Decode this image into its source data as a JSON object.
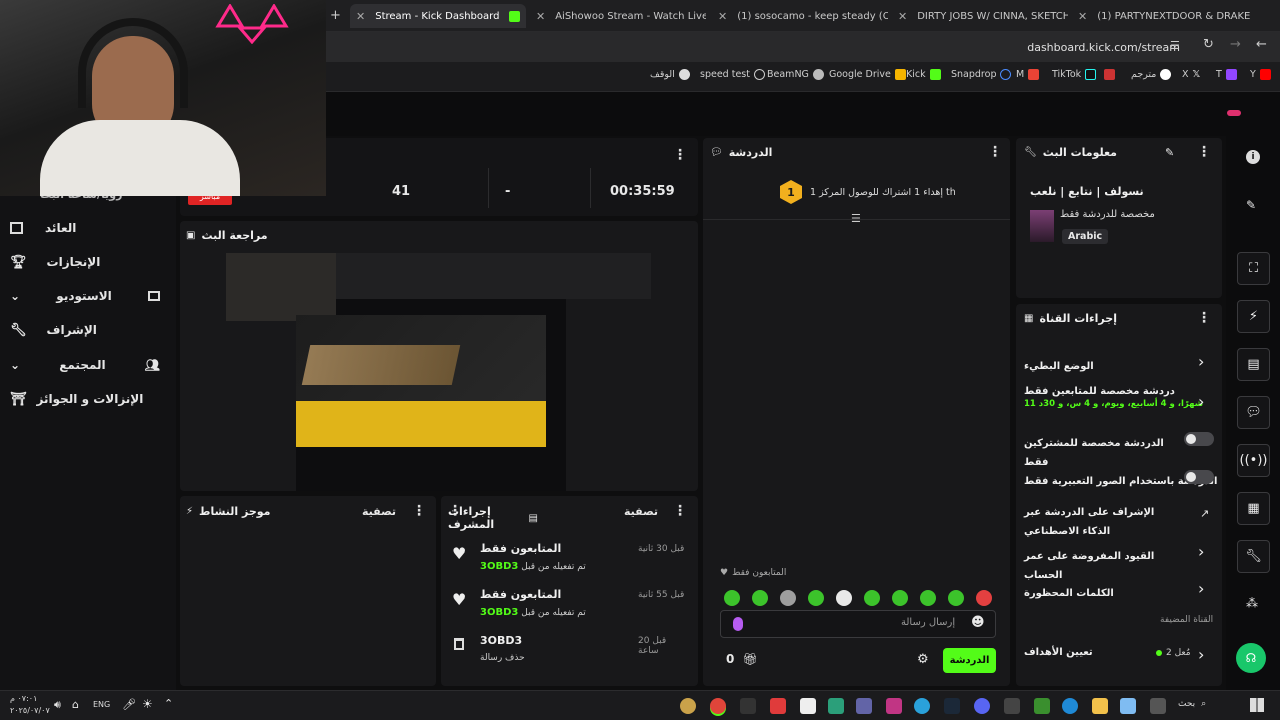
{
  "browser": {
    "tabs": [
      {
        "label": "Stream - Kick Dashboard",
        "active": true
      },
      {
        "label": "AiShowoo Stream - Watch Live on"
      },
      {
        "label": "(1) sosocamo - keep steady (Offici"
      },
      {
        "label": "DIRTY JOBS W/ CINNA, SKETCH, M"
      },
      {
        "label": "(1) PARTYNEXTDOOR & DRAKE - P"
      }
    ],
    "url": "dashboard.kick.com/stream",
    "bookmarks": [
      "الوقف",
      "speed test",
      "BeamNG",
      "Google Drive",
      "Kick",
      "Snapdrop",
      "M",
      "TikTok",
      "مترجم",
      "X",
      "T",
      "Y"
    ]
  },
  "stats": {
    "viewers": "41",
    "dash": "-",
    "uptime": "00:35:59",
    "live_badge": "مباشر"
  },
  "nav": {
    "partial": "رؤيا/ساعة البث",
    "items": [
      "العائد",
      "الإنجازات",
      "الاستوديو",
      "الإشراف",
      "المجتمع",
      "الإنزالات و الجوائز"
    ]
  },
  "preview": {
    "title": "مراجعة البث"
  },
  "activity": {
    "title": "موجز النشاط",
    "filter": "تصفية"
  },
  "modlog": {
    "title": "إجراءات المشرف",
    "filter": "تصفية",
    "entries": [
      {
        "time": "قبل 30 ثانية",
        "title": "المتابعون فقط",
        "sub": "تم تفعيله من قبل",
        "user": "3OBD3"
      },
      {
        "time": "قبل 55 ثانية",
        "title": "المتابعون فقط",
        "sub": "تم تفعيله من قبل",
        "user": "3OBD3"
      },
      {
        "time": "قبل 20 ساعة",
        "title": "3OBD3",
        "sub": "حذف رسالة",
        "user": ""
      }
    ]
  },
  "chat": {
    "title": "الدردشة",
    "gift_rank": "1",
    "gift_text": "إهداء 1 اشتراك للوصول المركز 1 th",
    "followers_only": "المتابعون فقط",
    "placeholder": "إرسال رسالة",
    "send_label": "الدردشة",
    "points": "0"
  },
  "stream_info": {
    "title": "معلومات البث",
    "stream_title": "نسولف | نتابع | نلعب",
    "subtitle": "مخصصة للدردشة فقط",
    "language": "Arabic"
  },
  "channel_actions": {
    "title": "إجراءات القناة",
    "items": [
      {
        "label": "الوضع البطيء",
        "control": "arrow"
      },
      {
        "label": "دردشة مخصصة للمتابعين فقط",
        "sub": "شهرًا، و 4 أسابيع، ويوم، و 4 س، و 30د 11",
        "control": "arrow"
      },
      {
        "label": "الدردشة مخصصة للمشتركين فقط",
        "control": "toggle"
      },
      {
        "label": "الدردشة باستخدام الصور التعبيرية فقط",
        "control": "toggle"
      },
      {
        "label": "الإشراف على الدردشة عبر الذكاء الاصطناعي",
        "control": "external"
      },
      {
        "label": "القيود المفروضة على عمر الحساب",
        "control": "arrow"
      },
      {
        "label": "الكلمات المحظورة",
        "control": "arrow"
      }
    ],
    "hosted": "القناة المضيفة",
    "goals": "تعيين الأهداف",
    "goals_count": "2 مُعل"
  },
  "taskbar": {
    "time": "٠٧:٠١ م",
    "date": "٢٠٢٥/٠٧/٠٧",
    "lang": "ENG",
    "search": "بحث"
  },
  "colors": {
    "accent": "#53fc18",
    "panel": "#18181a",
    "bg": "#0e0e0f"
  }
}
